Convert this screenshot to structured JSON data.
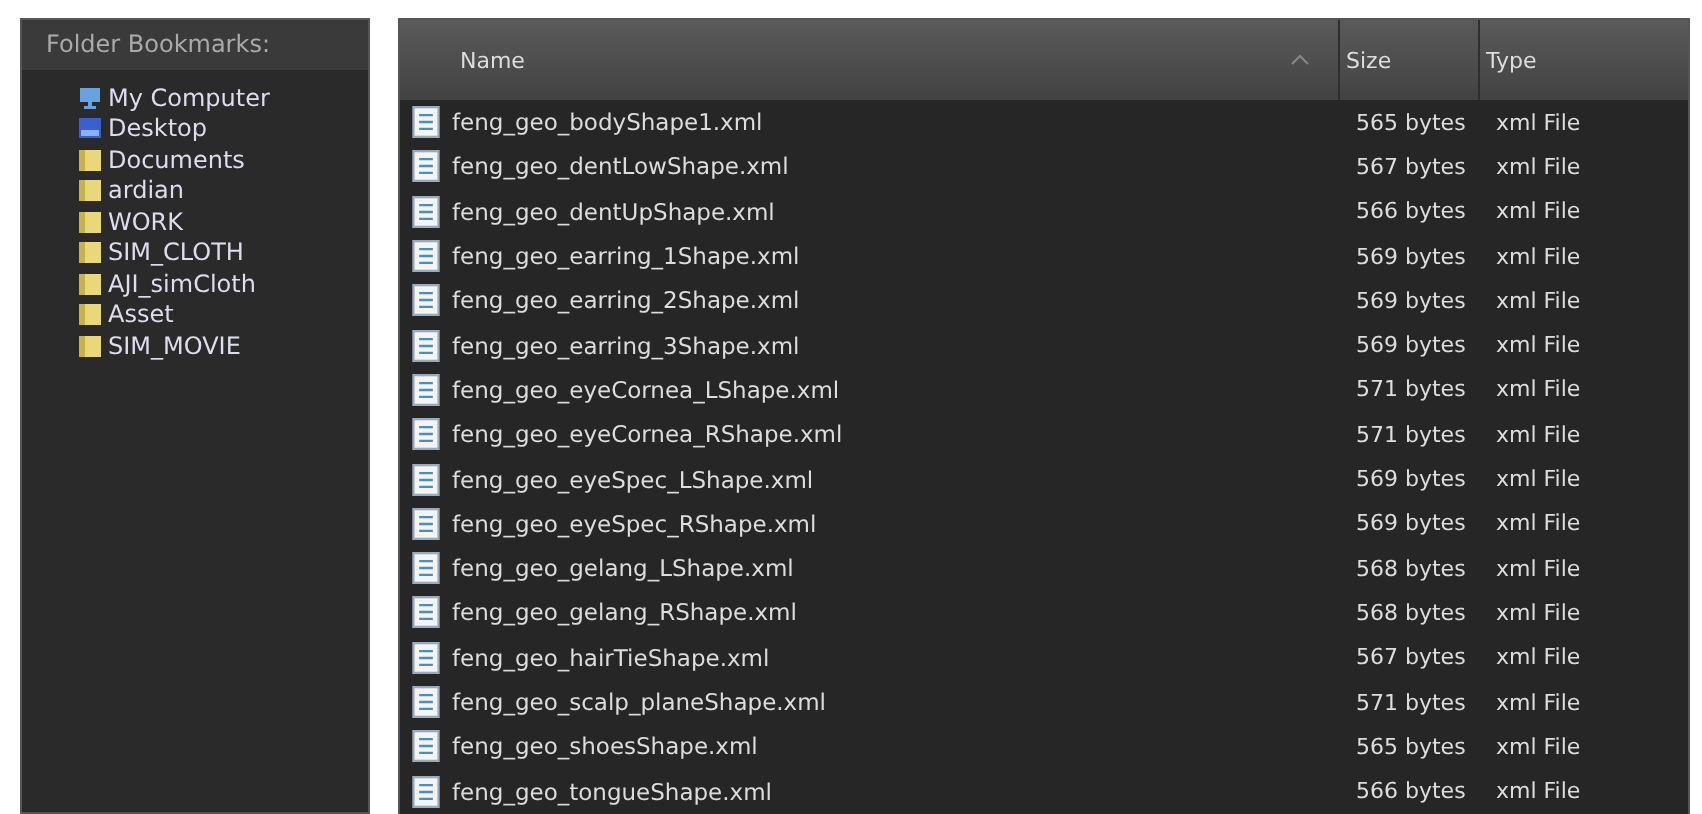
{
  "sidebar": {
    "title": "Folder Bookmarks:",
    "items": [
      {
        "label": "My Computer",
        "kind": "computer"
      },
      {
        "label": "Desktop",
        "kind": "desktop"
      },
      {
        "label": "Documents",
        "kind": "folder"
      },
      {
        "label": "ardian",
        "kind": "folder"
      },
      {
        "label": "WORK",
        "kind": "folder"
      },
      {
        "label": "SIM_CLOTH",
        "kind": "folder"
      },
      {
        "label": "AJI_simCloth",
        "kind": "folder"
      },
      {
        "label": "Asset",
        "kind": "folder"
      },
      {
        "label": "SIM_MOVIE",
        "kind": "folder"
      }
    ]
  },
  "table": {
    "columns": [
      "Name",
      "Size",
      "Type"
    ],
    "rows": [
      [
        "feng_geo_bodyShape1.xml",
        "565 bytes",
        "xml File"
      ],
      [
        "feng_geo_dentLowShape.xml",
        "567 bytes",
        "xml File"
      ],
      [
        "feng_geo_dentUpShape.xml",
        "566 bytes",
        "xml File"
      ],
      [
        "feng_geo_earring_1Shape.xml",
        "569 bytes",
        "xml File"
      ],
      [
        "feng_geo_earring_2Shape.xml",
        "569 bytes",
        "xml File"
      ],
      [
        "feng_geo_earring_3Shape.xml",
        "569 bytes",
        "xml File"
      ],
      [
        "feng_geo_eyeCornea_LShape.xml",
        "571 bytes",
        "xml File"
      ],
      [
        "feng_geo_eyeCornea_RShape.xml",
        "571 bytes",
        "xml File"
      ],
      [
        "feng_geo_eyeSpec_LShape.xml",
        "569 bytes",
        "xml File"
      ],
      [
        "feng_geo_eyeSpec_RShape.xml",
        "569 bytes",
        "xml File"
      ],
      [
        "feng_geo_gelang_LShape.xml",
        "568 bytes",
        "xml File"
      ],
      [
        "feng_geo_gelang_RShape.xml",
        "568 bytes",
        "xml File"
      ],
      [
        "feng_geo_hairTieShape.xml",
        "567 bytes",
        "xml File"
      ],
      [
        "feng_geo_scalp_planeShape.xml",
        "571 bytes",
        "xml File"
      ],
      [
        "feng_geo_shoesShape.xml",
        "565 bytes",
        "xml File"
      ],
      [
        "feng_geo_tongueShape.xml",
        "566 bytes",
        "xml File"
      ]
    ]
  }
}
